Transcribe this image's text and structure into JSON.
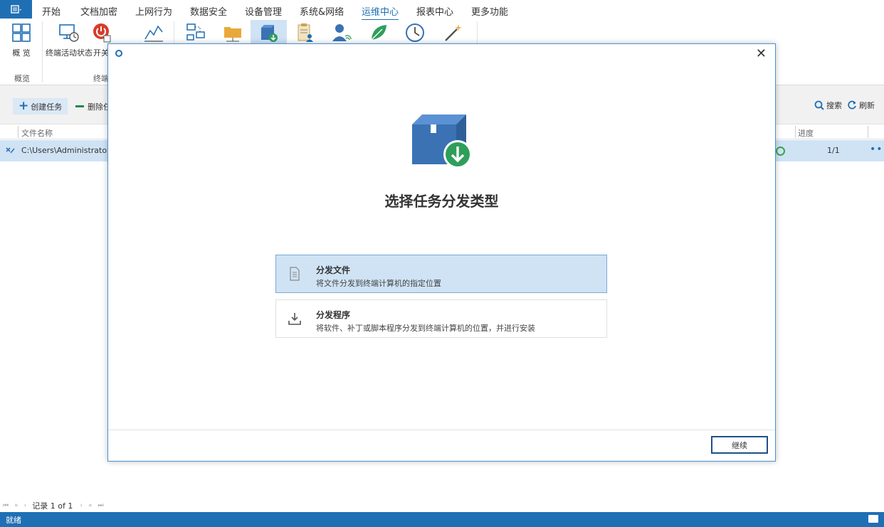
{
  "menu": {
    "items": [
      "开始",
      "文档加密",
      "上网行为",
      "数据安全",
      "设备管理",
      "系统&网络",
      "运维中心",
      "报表中心",
      "更多功能"
    ],
    "active": "运维中心"
  },
  "ribbon": {
    "tools": [
      {
        "label": "概 览",
        "icon": "overview-grid-icon"
      },
      {
        "label": "终端活动状态",
        "icon": "terminal-monitor-icon"
      },
      {
        "label": "开关",
        "icon": "power-switch-icon"
      },
      {
        "label": "",
        "icon": "chart-line-icon"
      },
      {
        "label": "",
        "icon": "network-computers-icon"
      },
      {
        "label": "",
        "icon": "folder-network-icon"
      },
      {
        "label": "",
        "icon": "package-download-icon"
      },
      {
        "label": "",
        "icon": "clipboard-user-icon"
      },
      {
        "label": "",
        "icon": "user-fingerprint-icon"
      },
      {
        "label": "",
        "icon": "leaf-icon"
      },
      {
        "label": "",
        "icon": "clock-icon"
      },
      {
        "label": "",
        "icon": "magic-wand-icon"
      }
    ],
    "groups": [
      "概览",
      "终端"
    ]
  },
  "toolbar": {
    "create_task": "创建任务",
    "delete_task": "删除任",
    "search": "搜索",
    "refresh": "刷新"
  },
  "grid": {
    "columns": [
      "文件名称",
      "进度"
    ],
    "rows": [
      {
        "path": "C:\\Users\\Administrator\\D",
        "progress": "1/1"
      }
    ]
  },
  "pager": {
    "record_text": "记录 1 of 1"
  },
  "status": {
    "text": "就绪"
  },
  "dialog": {
    "title_heading": "选择任务分发类型",
    "options": [
      {
        "title": "分发文件",
        "desc": "将文件分发到终端计算机的指定位置",
        "icon": "document-icon",
        "selected": true
      },
      {
        "title": "分发程序",
        "desc": "将软件、补丁或脚本程序分发到终端计算机的位置，并进行安装",
        "icon": "download-tray-icon",
        "selected": false
      }
    ],
    "continue_label": "继续",
    "close_glyph": "✕"
  },
  "colors": {
    "accent": "#1f6fb5",
    "selection": "#cfe3f5",
    "status_ok": "#3aa64b"
  }
}
